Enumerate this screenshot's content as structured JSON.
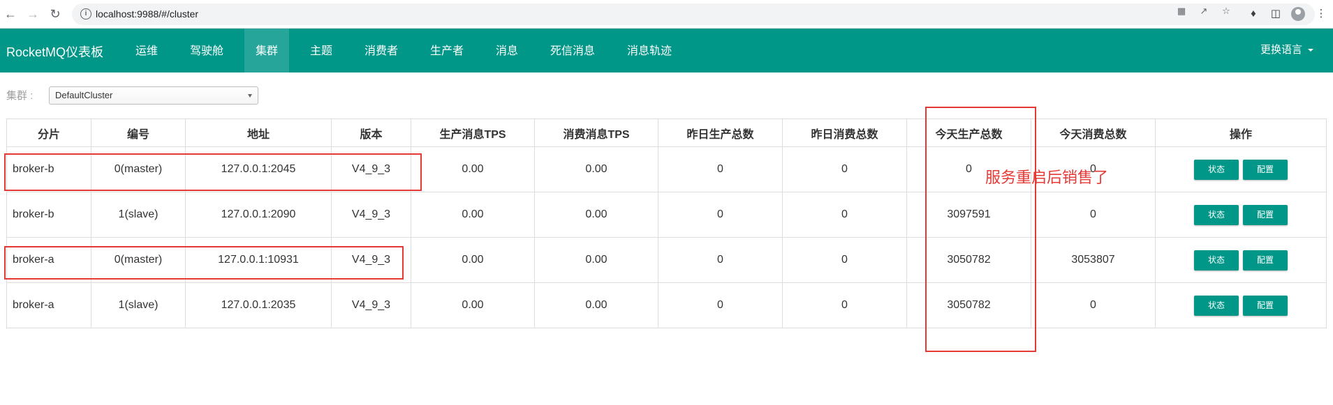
{
  "browser": {
    "url": "localhost:9988/#/cluster"
  },
  "navbar": {
    "brand": "RocketMQ仪表板",
    "items": [
      {
        "label": "运维"
      },
      {
        "label": "驾驶舱"
      },
      {
        "label": "集群",
        "active": true
      },
      {
        "label": "主题"
      },
      {
        "label": "消费者"
      },
      {
        "label": "生产者"
      },
      {
        "label": "消息"
      },
      {
        "label": "死信消息"
      },
      {
        "label": "消息轨迹"
      }
    ],
    "language_label": "更换语言"
  },
  "cluster": {
    "label": "集群 :",
    "selected": "DefaultCluster"
  },
  "table": {
    "headers": [
      "分片",
      "编号",
      "地址",
      "版本",
      "生产消息TPS",
      "消费消息TPS",
      "昨日生产总数",
      "昨日消费总数",
      "今天生产总数",
      "今天消费总数",
      "操作"
    ],
    "rows": [
      {
        "shard": "broker-b",
        "id": "0(master)",
        "address": "127.0.0.1:2045",
        "version": "V4_9_3",
        "produce_tps": "0.00",
        "consume_tps": "0.00",
        "yesterday_produce": "0",
        "yesterday_consume": "0",
        "today_produce": "0",
        "today_consume": "0"
      },
      {
        "shard": "broker-b",
        "id": "1(slave)",
        "address": "127.0.0.1:2090",
        "version": "V4_9_3",
        "produce_tps": "0.00",
        "consume_tps": "0.00",
        "yesterday_produce": "0",
        "yesterday_consume": "0",
        "today_produce": "3097591",
        "today_consume": "0"
      },
      {
        "shard": "broker-a",
        "id": "0(master)",
        "address": "127.0.0.1:10931",
        "version": "V4_9_3",
        "produce_tps": "0.00",
        "consume_tps": "0.00",
        "yesterday_produce": "0",
        "yesterday_consume": "0",
        "today_produce": "3050782",
        "today_consume": "3053807"
      },
      {
        "shard": "broker-a",
        "id": "1(slave)",
        "address": "127.0.0.1:2035",
        "version": "V4_9_3",
        "produce_tps": "0.00",
        "consume_tps": "0.00",
        "yesterday_produce": "0",
        "yesterday_consume": "0",
        "today_produce": "3050782",
        "today_consume": "0"
      }
    ],
    "action_status": "状态",
    "action_config": "配置"
  },
  "annotation": {
    "note": "服务重启后销售了",
    "color": "#e53935"
  },
  "colors": {
    "primary": "#009688",
    "active_nav": "#26a69a"
  }
}
